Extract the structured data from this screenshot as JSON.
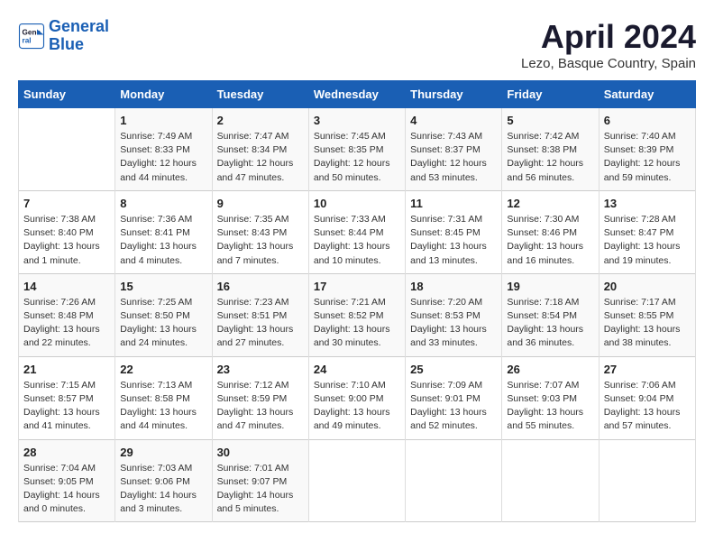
{
  "header": {
    "logo_line1": "General",
    "logo_line2": "Blue",
    "month": "April 2024",
    "location": "Lezo, Basque Country, Spain"
  },
  "weekdays": [
    "Sunday",
    "Monday",
    "Tuesday",
    "Wednesday",
    "Thursday",
    "Friday",
    "Saturday"
  ],
  "weeks": [
    [
      {
        "day": "",
        "info": ""
      },
      {
        "day": "1",
        "info": "Sunrise: 7:49 AM\nSunset: 8:33 PM\nDaylight: 12 hours\nand 44 minutes."
      },
      {
        "day": "2",
        "info": "Sunrise: 7:47 AM\nSunset: 8:34 PM\nDaylight: 12 hours\nand 47 minutes."
      },
      {
        "day": "3",
        "info": "Sunrise: 7:45 AM\nSunset: 8:35 PM\nDaylight: 12 hours\nand 50 minutes."
      },
      {
        "day": "4",
        "info": "Sunrise: 7:43 AM\nSunset: 8:37 PM\nDaylight: 12 hours\nand 53 minutes."
      },
      {
        "day": "5",
        "info": "Sunrise: 7:42 AM\nSunset: 8:38 PM\nDaylight: 12 hours\nand 56 minutes."
      },
      {
        "day": "6",
        "info": "Sunrise: 7:40 AM\nSunset: 8:39 PM\nDaylight: 12 hours\nand 59 minutes."
      }
    ],
    [
      {
        "day": "7",
        "info": "Sunrise: 7:38 AM\nSunset: 8:40 PM\nDaylight: 13 hours\nand 1 minute."
      },
      {
        "day": "8",
        "info": "Sunrise: 7:36 AM\nSunset: 8:41 PM\nDaylight: 13 hours\nand 4 minutes."
      },
      {
        "day": "9",
        "info": "Sunrise: 7:35 AM\nSunset: 8:43 PM\nDaylight: 13 hours\nand 7 minutes."
      },
      {
        "day": "10",
        "info": "Sunrise: 7:33 AM\nSunset: 8:44 PM\nDaylight: 13 hours\nand 10 minutes."
      },
      {
        "day": "11",
        "info": "Sunrise: 7:31 AM\nSunset: 8:45 PM\nDaylight: 13 hours\nand 13 minutes."
      },
      {
        "day": "12",
        "info": "Sunrise: 7:30 AM\nSunset: 8:46 PM\nDaylight: 13 hours\nand 16 minutes."
      },
      {
        "day": "13",
        "info": "Sunrise: 7:28 AM\nSunset: 8:47 PM\nDaylight: 13 hours\nand 19 minutes."
      }
    ],
    [
      {
        "day": "14",
        "info": "Sunrise: 7:26 AM\nSunset: 8:48 PM\nDaylight: 13 hours\nand 22 minutes."
      },
      {
        "day": "15",
        "info": "Sunrise: 7:25 AM\nSunset: 8:50 PM\nDaylight: 13 hours\nand 24 minutes."
      },
      {
        "day": "16",
        "info": "Sunrise: 7:23 AM\nSunset: 8:51 PM\nDaylight: 13 hours\nand 27 minutes."
      },
      {
        "day": "17",
        "info": "Sunrise: 7:21 AM\nSunset: 8:52 PM\nDaylight: 13 hours\nand 30 minutes."
      },
      {
        "day": "18",
        "info": "Sunrise: 7:20 AM\nSunset: 8:53 PM\nDaylight: 13 hours\nand 33 minutes."
      },
      {
        "day": "19",
        "info": "Sunrise: 7:18 AM\nSunset: 8:54 PM\nDaylight: 13 hours\nand 36 minutes."
      },
      {
        "day": "20",
        "info": "Sunrise: 7:17 AM\nSunset: 8:55 PM\nDaylight: 13 hours\nand 38 minutes."
      }
    ],
    [
      {
        "day": "21",
        "info": "Sunrise: 7:15 AM\nSunset: 8:57 PM\nDaylight: 13 hours\nand 41 minutes."
      },
      {
        "day": "22",
        "info": "Sunrise: 7:13 AM\nSunset: 8:58 PM\nDaylight: 13 hours\nand 44 minutes."
      },
      {
        "day": "23",
        "info": "Sunrise: 7:12 AM\nSunset: 8:59 PM\nDaylight: 13 hours\nand 47 minutes."
      },
      {
        "day": "24",
        "info": "Sunrise: 7:10 AM\nSunset: 9:00 PM\nDaylight: 13 hours\nand 49 minutes."
      },
      {
        "day": "25",
        "info": "Sunrise: 7:09 AM\nSunset: 9:01 PM\nDaylight: 13 hours\nand 52 minutes."
      },
      {
        "day": "26",
        "info": "Sunrise: 7:07 AM\nSunset: 9:03 PM\nDaylight: 13 hours\nand 55 minutes."
      },
      {
        "day": "27",
        "info": "Sunrise: 7:06 AM\nSunset: 9:04 PM\nDaylight: 13 hours\nand 57 minutes."
      }
    ],
    [
      {
        "day": "28",
        "info": "Sunrise: 7:04 AM\nSunset: 9:05 PM\nDaylight: 14 hours\nand 0 minutes."
      },
      {
        "day": "29",
        "info": "Sunrise: 7:03 AM\nSunset: 9:06 PM\nDaylight: 14 hours\nand 3 minutes."
      },
      {
        "day": "30",
        "info": "Sunrise: 7:01 AM\nSunset: 9:07 PM\nDaylight: 14 hours\nand 5 minutes."
      },
      {
        "day": "",
        "info": ""
      },
      {
        "day": "",
        "info": ""
      },
      {
        "day": "",
        "info": ""
      },
      {
        "day": "",
        "info": ""
      }
    ]
  ]
}
